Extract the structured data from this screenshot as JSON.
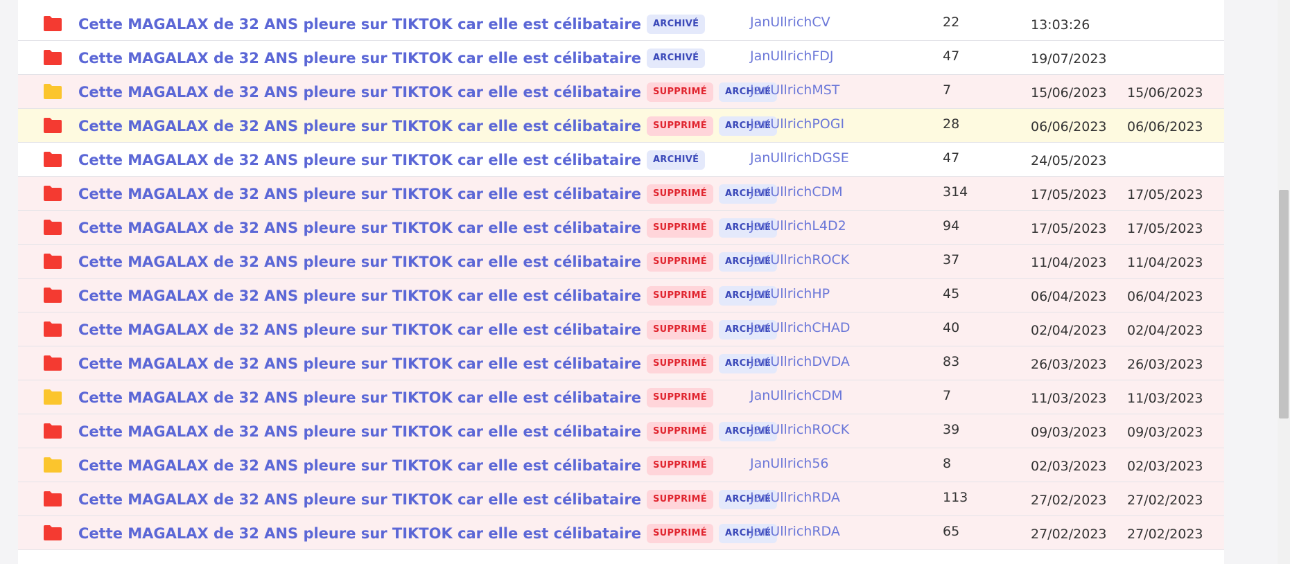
{
  "colors": {
    "folder_red": "#f43a31",
    "folder_yellow": "#fbc52d",
    "link": "#5b67d6",
    "deleted_badge_bg": "#ffd5da",
    "deleted_badge_text": "#e0252f",
    "archived_badge_bg": "#e4e9fb",
    "archived_badge_text": "#3b49b9"
  },
  "badge_labels": {
    "deleted": "SUPPRIMÉ",
    "archived": "ARCHIVÉ"
  },
  "topics": [
    {
      "folder": "red",
      "folder_icon": "folder-icon",
      "title": "Cette MAGALAX de 32 ANS pleure sur TIKTOK car elle est célibataire",
      "deleted": false,
      "archived": true,
      "author": "JanUllrichCV",
      "replies": "22",
      "date": "13:03:26",
      "last_date": "",
      "row_state": "normal"
    },
    {
      "folder": "red",
      "folder_icon": "folder-icon",
      "title": "Cette MAGALAX de 32 ANS pleure sur TIKTOK car elle est célibataire",
      "deleted": false,
      "archived": true,
      "author": "JanUllrichFDJ",
      "replies": "47",
      "date": "19/07/2023",
      "last_date": "",
      "row_state": "normal"
    },
    {
      "folder": "yellow",
      "folder_icon": "folder-icon",
      "title": "Cette MAGALAX de 32 ANS pleure sur TIKTOK car elle est célibataire",
      "deleted": true,
      "archived": true,
      "author": "JanUllrichMST",
      "replies": "7",
      "date": "15/06/2023",
      "last_date": "15/06/2023",
      "row_state": "deleted"
    },
    {
      "folder": "red",
      "folder_icon": "folder-icon",
      "title": "Cette MAGALAX de 32 ANS pleure sur TIKTOK car elle est célibataire",
      "deleted": true,
      "archived": true,
      "author": "JanUllrichPOGI",
      "replies": "28",
      "date": "06/06/2023",
      "last_date": "06/06/2023",
      "row_state": "highlight"
    },
    {
      "folder": "red",
      "folder_icon": "folder-icon",
      "title": "Cette MAGALAX de 32 ANS pleure sur TIKTOK car elle est célibataire",
      "deleted": false,
      "archived": true,
      "author": "JanUllrichDGSE",
      "replies": "47",
      "date": "24/05/2023",
      "last_date": "",
      "row_state": "normal"
    },
    {
      "folder": "red",
      "folder_icon": "folder-icon",
      "title": "Cette MAGALAX de 32 ANS pleure sur TIKTOK car elle est célibataire",
      "deleted": true,
      "archived": true,
      "author": "JanUllrichCDM",
      "replies": "314",
      "date": "17/05/2023",
      "last_date": "17/05/2023",
      "row_state": "deleted"
    },
    {
      "folder": "red",
      "folder_icon": "folder-icon",
      "title": "Cette MAGALAX de 32 ANS pleure sur TIKTOK car elle est célibataire",
      "deleted": true,
      "archived": true,
      "author": "JanUllrichL4D2",
      "replies": "94",
      "date": "17/05/2023",
      "last_date": "17/05/2023",
      "row_state": "deleted"
    },
    {
      "folder": "red",
      "folder_icon": "folder-icon",
      "title": "Cette MAGALAX de 32 ANS pleure sur TIKTOK car elle est célibataire",
      "deleted": true,
      "archived": true,
      "author": "JanUllrichROCK",
      "replies": "37",
      "date": "11/04/2023",
      "last_date": "11/04/2023",
      "row_state": "deleted"
    },
    {
      "folder": "red",
      "folder_icon": "folder-icon",
      "title": "Cette MAGALAX de 32 ANS pleure sur TIKTOK car elle est célibataire",
      "deleted": true,
      "archived": true,
      "author": "JanUllrichHP",
      "replies": "45",
      "date": "06/04/2023",
      "last_date": "06/04/2023",
      "row_state": "deleted"
    },
    {
      "folder": "red",
      "folder_icon": "folder-icon",
      "title": "Cette MAGALAX de 32 ANS pleure sur TIKTOK car elle est célibataire",
      "deleted": true,
      "archived": true,
      "author": "JanUllrichCHAD",
      "replies": "40",
      "date": "02/04/2023",
      "last_date": "02/04/2023",
      "row_state": "deleted"
    },
    {
      "folder": "red",
      "folder_icon": "folder-icon",
      "title": "Cette MAGALAX de 32 ANS pleure sur TIKTOK car elle est célibataire",
      "deleted": true,
      "archived": true,
      "author": "JanUllrichDVDA",
      "replies": "83",
      "date": "26/03/2023",
      "last_date": "26/03/2023",
      "row_state": "deleted"
    },
    {
      "folder": "yellow",
      "folder_icon": "folder-icon",
      "title": "Cette MAGALAX de 32 ANS pleure sur TIKTOK car elle est célibataire",
      "deleted": true,
      "archived": false,
      "author": "JanUllrichCDM",
      "replies": "7",
      "date": "11/03/2023",
      "last_date": "11/03/2023",
      "row_state": "deleted"
    },
    {
      "folder": "red",
      "folder_icon": "folder-icon",
      "title": "Cette MAGALAX de 32 ANS pleure sur TIKTOK car elle est célibataire",
      "deleted": true,
      "archived": true,
      "author": "JanUllrichROCK",
      "replies": "39",
      "date": "09/03/2023",
      "last_date": "09/03/2023",
      "row_state": "deleted"
    },
    {
      "folder": "yellow",
      "folder_icon": "folder-icon",
      "title": "Cette MAGALAX de 32 ANS pleure sur TIKTOK car elle est célibataire",
      "deleted": true,
      "archived": false,
      "author": "JanUllrich56",
      "replies": "8",
      "date": "02/03/2023",
      "last_date": "02/03/2023",
      "row_state": "deleted"
    },
    {
      "folder": "red",
      "folder_icon": "folder-icon",
      "title": "Cette MAGALAX de 32 ANS pleure sur TIKTOK car elle est célibataire",
      "deleted": true,
      "archived": true,
      "author": "JanUllrichRDA",
      "replies": "113",
      "date": "27/02/2023",
      "last_date": "27/02/2023",
      "row_state": "deleted"
    },
    {
      "folder": "red",
      "folder_icon": "folder-icon",
      "title": "Cette MAGALAX de 32 ANS pleure sur TIKTOK car elle est célibataire",
      "deleted": true,
      "archived": true,
      "author": "JanUllrichRDA",
      "replies": "65",
      "date": "27/02/2023",
      "last_date": "27/02/2023",
      "row_state": "deleted"
    }
  ]
}
